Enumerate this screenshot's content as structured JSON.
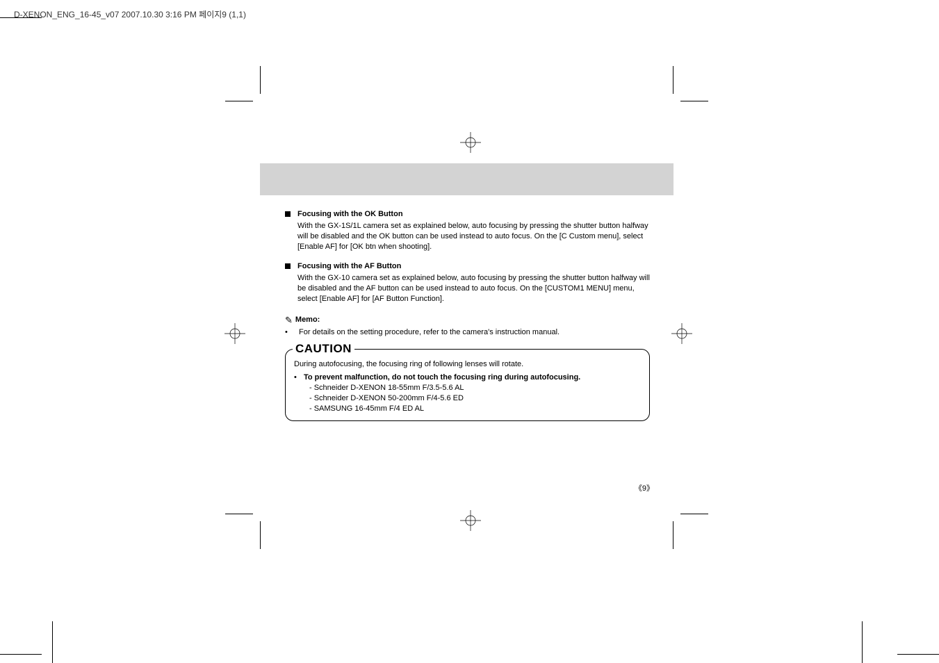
{
  "header": {
    "filename_line": "D-XENON_ENG_16-45_v07  2007.10.30 3:16 PM  페이지9   (1,1)"
  },
  "section1": {
    "title": "Focusing with the OK Button",
    "body": "With the GX-1S/1L camera set as explained below, auto focusing by pressing the shutter button halfway will be disabled and the OK button can be used instead to auto focus. On the [C Custom menu], select [Enable AF] for  [OK btn when shooting]."
  },
  "section2": {
    "title": "Focusing with the AF Button",
    "body": "With the GX-10 camera set as explained below, auto focusing by pressing the shutter button halfway will be disabled and the AF button can be used instead to auto focus. On the [CUSTOM1 MENU] menu, select  [Enable AF] for [AF Button Function]."
  },
  "memo": {
    "title": "Memo:",
    "bullet": "•",
    "body": "For details on the setting procedure, refer to the camera's instruction manual."
  },
  "caution": {
    "label": "CAUTION",
    "intro": "During autofocusing, the focusing ring of following lenses will rotate.",
    "bullet": "•",
    "main": "To prevent malfunction, do not touch the focusing ring during autofocusing.",
    "items": [
      "- Schneider D-XENON 18-55mm F/3.5-5.6 AL",
      "- Schneider D-XENON 50-200mm F/4-5.6 ED",
      "- SAMSUNG 16-45mm F/4 ED AL"
    ]
  },
  "page_number": "9"
}
